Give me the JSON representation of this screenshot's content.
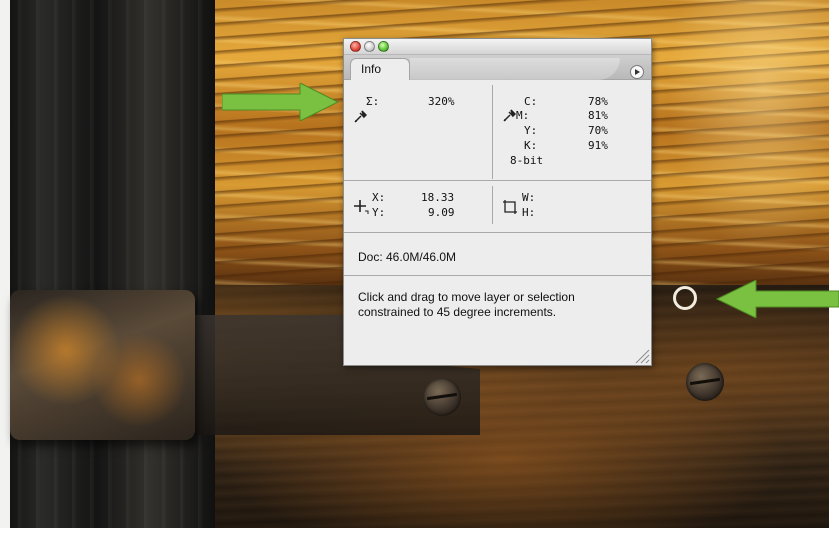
{
  "window": {
    "traffic_lights": [
      "close",
      "minimize",
      "zoom"
    ],
    "tab_label": "Info",
    "menu_icon": "panel-menu-icon"
  },
  "top_section": {
    "sum_label": "Σ:",
    "sum_value": "320%",
    "cmyk": {
      "c_label": "C:",
      "c_value": "78%",
      "m_label": "M:",
      "m_value": "81%",
      "y_label": "Y:",
      "y_value": "70%",
      "k_label": "K:",
      "k_value": "91%",
      "bit_depth": "8-bit"
    }
  },
  "position_section": {
    "x_label": "X:",
    "x_value": "18.33",
    "y_label": "Y:",
    "y_value": "9.09",
    "w_label": "W:",
    "w_value": "",
    "h_label": "H:",
    "h_value": ""
  },
  "doc_info": "Doc: 46.0M/46.0M",
  "status_text": {
    "line1": "Click and drag to move layer or selection",
    "line2": "constrained to 45 degree increments."
  },
  "colors": {
    "arrow": "#7ac142",
    "palette_bg": "#ededed"
  }
}
